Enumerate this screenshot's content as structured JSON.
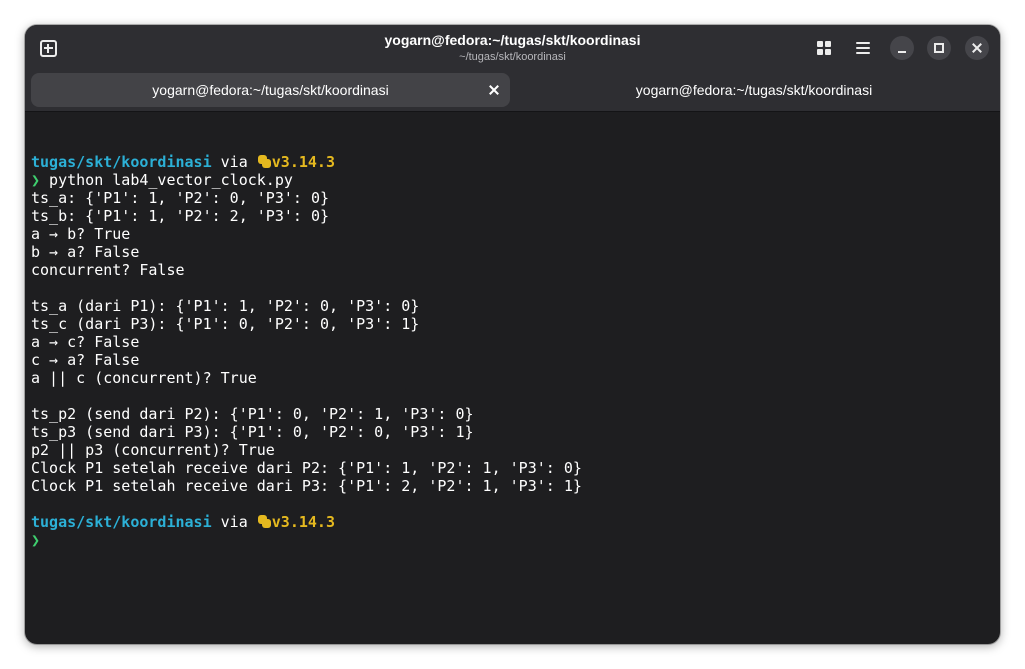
{
  "window": {
    "title": "yogarn@fedora:~/tugas/skt/koordinasi",
    "subtitle": "~/tugas/skt/koordinasi"
  },
  "tabs": [
    {
      "label": "yogarn@fedora:~/tugas/skt/koordinasi",
      "active": true
    },
    {
      "label": "yogarn@fedora:~/tugas/skt/koordinasi",
      "active": false
    }
  ],
  "prompt": {
    "path": "tugas/skt/koordinasi",
    "via": " via ",
    "python_icon": "python-icon",
    "version": "v3.14.3",
    "arrow": "❯"
  },
  "command": " python lab4_vector_clock.py",
  "output": [
    "ts_a: {'P1': 1, 'P2': 0, 'P3': 0}",
    "ts_b: {'P1': 1, 'P2': 2, 'P3': 0}",
    "a → b? True",
    "b → a? False",
    "concurrent? False",
    "",
    "ts_a (dari P1): {'P1': 1, 'P2': 0, 'P3': 0}",
    "ts_c (dari P3): {'P1': 0, 'P2': 0, 'P3': 1}",
    "a → c? False",
    "c → a? False",
    "a || c (concurrent)? True",
    "",
    "ts_p2 (send dari P2): {'P1': 0, 'P2': 1, 'P3': 0}",
    "ts_p3 (send dari P3): {'P1': 0, 'P2': 0, 'P3': 1}",
    "p2 || p3 (concurrent)? True",
    "Clock P1 setelah receive dari P2: {'P1': 1, 'P2': 1, 'P3': 0}",
    "Clock P1 setelah receive dari P3: {'P1': 2, 'P2': 1, 'P3': 1}",
    ""
  ],
  "colors": {
    "path": "#2cb0d6",
    "version": "#e5b91f",
    "arrow": "#3fcf6f",
    "background": "#1e1e20",
    "headerbar": "#2e2e32"
  }
}
